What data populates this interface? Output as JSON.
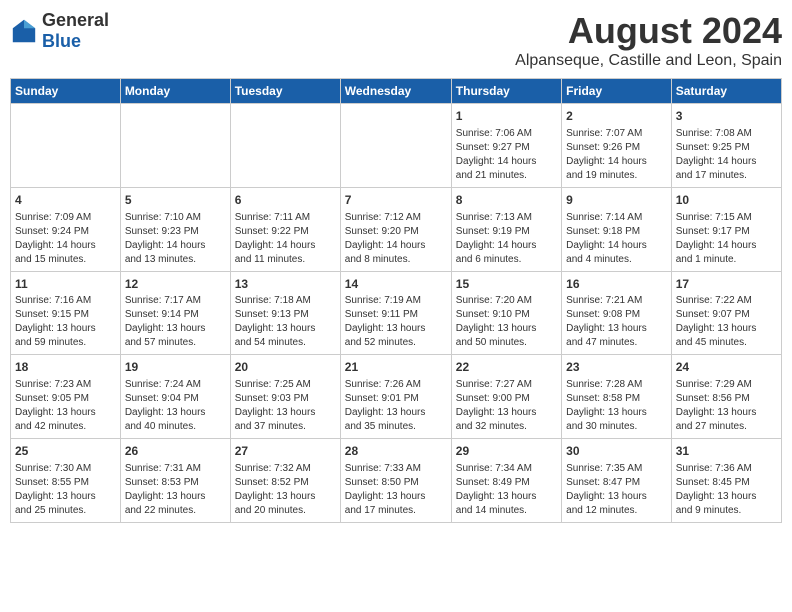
{
  "header": {
    "logo_general": "General",
    "logo_blue": "Blue",
    "month_year": "August 2024",
    "location": "Alpanseque, Castille and Leon, Spain"
  },
  "weekdays": [
    "Sunday",
    "Monday",
    "Tuesday",
    "Wednesday",
    "Thursday",
    "Friday",
    "Saturday"
  ],
  "weeks": [
    [
      {
        "num": "",
        "info": ""
      },
      {
        "num": "",
        "info": ""
      },
      {
        "num": "",
        "info": ""
      },
      {
        "num": "",
        "info": ""
      },
      {
        "num": "1",
        "info": "Sunrise: 7:06 AM\nSunset: 9:27 PM\nDaylight: 14 hours\nand 21 minutes."
      },
      {
        "num": "2",
        "info": "Sunrise: 7:07 AM\nSunset: 9:26 PM\nDaylight: 14 hours\nand 19 minutes."
      },
      {
        "num": "3",
        "info": "Sunrise: 7:08 AM\nSunset: 9:25 PM\nDaylight: 14 hours\nand 17 minutes."
      }
    ],
    [
      {
        "num": "4",
        "info": "Sunrise: 7:09 AM\nSunset: 9:24 PM\nDaylight: 14 hours\nand 15 minutes."
      },
      {
        "num": "5",
        "info": "Sunrise: 7:10 AM\nSunset: 9:23 PM\nDaylight: 14 hours\nand 13 minutes."
      },
      {
        "num": "6",
        "info": "Sunrise: 7:11 AM\nSunset: 9:22 PM\nDaylight: 14 hours\nand 11 minutes."
      },
      {
        "num": "7",
        "info": "Sunrise: 7:12 AM\nSunset: 9:20 PM\nDaylight: 14 hours\nand 8 minutes."
      },
      {
        "num": "8",
        "info": "Sunrise: 7:13 AM\nSunset: 9:19 PM\nDaylight: 14 hours\nand 6 minutes."
      },
      {
        "num": "9",
        "info": "Sunrise: 7:14 AM\nSunset: 9:18 PM\nDaylight: 14 hours\nand 4 minutes."
      },
      {
        "num": "10",
        "info": "Sunrise: 7:15 AM\nSunset: 9:17 PM\nDaylight: 14 hours\nand 1 minute."
      }
    ],
    [
      {
        "num": "11",
        "info": "Sunrise: 7:16 AM\nSunset: 9:15 PM\nDaylight: 13 hours\nand 59 minutes."
      },
      {
        "num": "12",
        "info": "Sunrise: 7:17 AM\nSunset: 9:14 PM\nDaylight: 13 hours\nand 57 minutes."
      },
      {
        "num": "13",
        "info": "Sunrise: 7:18 AM\nSunset: 9:13 PM\nDaylight: 13 hours\nand 54 minutes."
      },
      {
        "num": "14",
        "info": "Sunrise: 7:19 AM\nSunset: 9:11 PM\nDaylight: 13 hours\nand 52 minutes."
      },
      {
        "num": "15",
        "info": "Sunrise: 7:20 AM\nSunset: 9:10 PM\nDaylight: 13 hours\nand 50 minutes."
      },
      {
        "num": "16",
        "info": "Sunrise: 7:21 AM\nSunset: 9:08 PM\nDaylight: 13 hours\nand 47 minutes."
      },
      {
        "num": "17",
        "info": "Sunrise: 7:22 AM\nSunset: 9:07 PM\nDaylight: 13 hours\nand 45 minutes."
      }
    ],
    [
      {
        "num": "18",
        "info": "Sunrise: 7:23 AM\nSunset: 9:05 PM\nDaylight: 13 hours\nand 42 minutes."
      },
      {
        "num": "19",
        "info": "Sunrise: 7:24 AM\nSunset: 9:04 PM\nDaylight: 13 hours\nand 40 minutes."
      },
      {
        "num": "20",
        "info": "Sunrise: 7:25 AM\nSunset: 9:03 PM\nDaylight: 13 hours\nand 37 minutes."
      },
      {
        "num": "21",
        "info": "Sunrise: 7:26 AM\nSunset: 9:01 PM\nDaylight: 13 hours\nand 35 minutes."
      },
      {
        "num": "22",
        "info": "Sunrise: 7:27 AM\nSunset: 9:00 PM\nDaylight: 13 hours\nand 32 minutes."
      },
      {
        "num": "23",
        "info": "Sunrise: 7:28 AM\nSunset: 8:58 PM\nDaylight: 13 hours\nand 30 minutes."
      },
      {
        "num": "24",
        "info": "Sunrise: 7:29 AM\nSunset: 8:56 PM\nDaylight: 13 hours\nand 27 minutes."
      }
    ],
    [
      {
        "num": "25",
        "info": "Sunrise: 7:30 AM\nSunset: 8:55 PM\nDaylight: 13 hours\nand 25 minutes."
      },
      {
        "num": "26",
        "info": "Sunrise: 7:31 AM\nSunset: 8:53 PM\nDaylight: 13 hours\nand 22 minutes."
      },
      {
        "num": "27",
        "info": "Sunrise: 7:32 AM\nSunset: 8:52 PM\nDaylight: 13 hours\nand 20 minutes."
      },
      {
        "num": "28",
        "info": "Sunrise: 7:33 AM\nSunset: 8:50 PM\nDaylight: 13 hours\nand 17 minutes."
      },
      {
        "num": "29",
        "info": "Sunrise: 7:34 AM\nSunset: 8:49 PM\nDaylight: 13 hours\nand 14 minutes."
      },
      {
        "num": "30",
        "info": "Sunrise: 7:35 AM\nSunset: 8:47 PM\nDaylight: 13 hours\nand 12 minutes."
      },
      {
        "num": "31",
        "info": "Sunrise: 7:36 AM\nSunset: 8:45 PM\nDaylight: 13 hours\nand 9 minutes."
      }
    ]
  ]
}
